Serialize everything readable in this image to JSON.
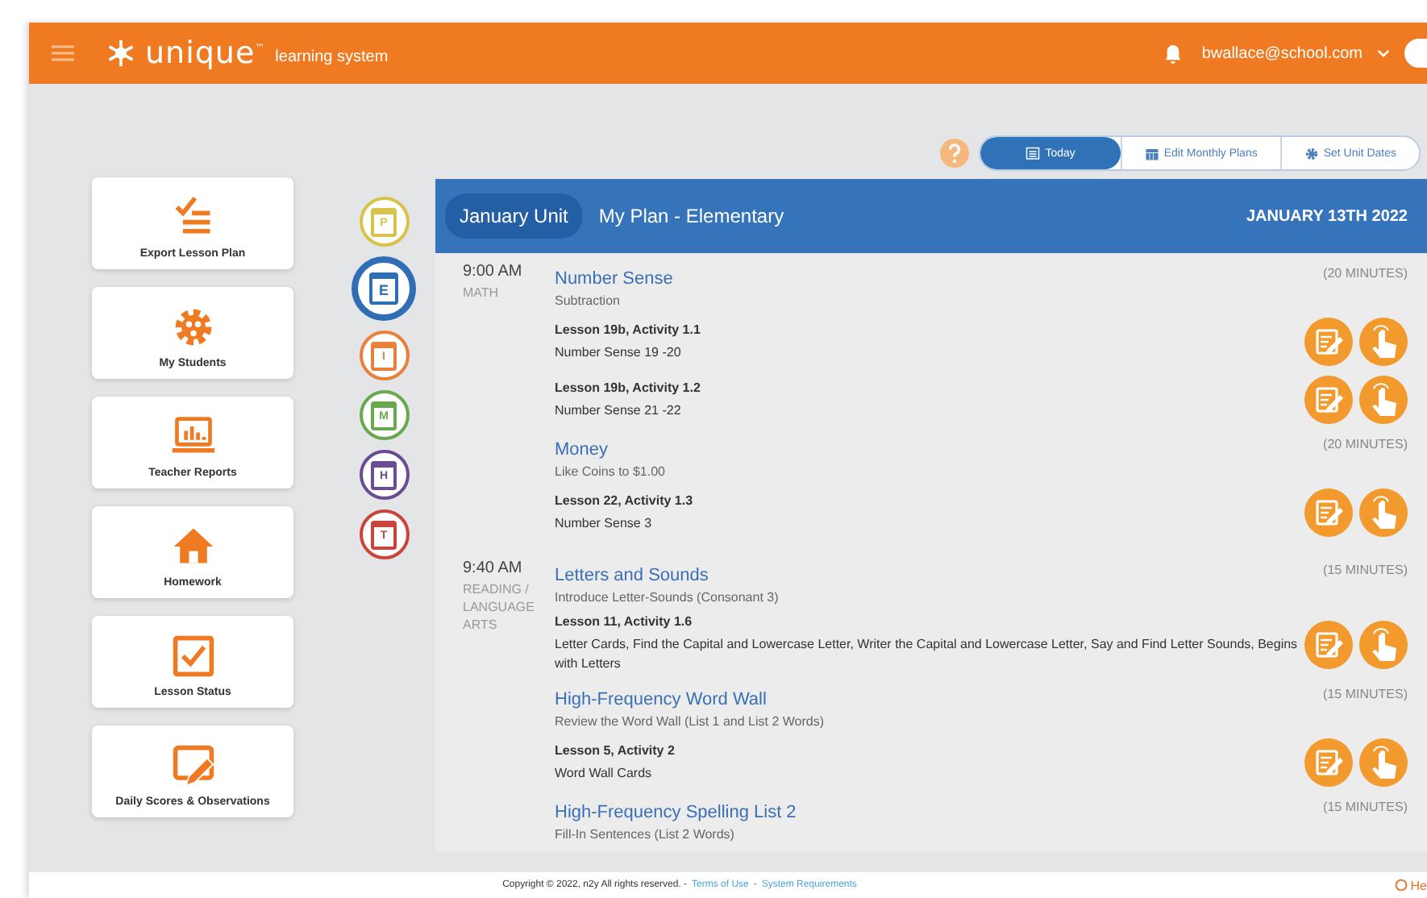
{
  "header": {
    "brand": "unique$^{™}$",
    "tagline": "learning system",
    "user": "bwallace@school.com"
  },
  "toolbar": {
    "tabs": [
      {
        "label": "Today",
        "kind": "list",
        "selected": true
      },
      {
        "label": "Edit Monthly Plans",
        "kind": "calendar",
        "selected": false
      },
      {
        "label": "Set Unit Dates",
        "kind": "gear",
        "selected": false
      }
    ]
  },
  "sidebar": {
    "items": [
      {
        "label": "Export Lesson Plan",
        "kind": "checklist"
      },
      {
        "label": "My Students",
        "kind": "gear"
      },
      {
        "label": "Teacher Reports",
        "kind": "laptop"
      },
      {
        "label": "Homework",
        "kind": "house"
      },
      {
        "label": "Lesson Status",
        "kind": "checkbox"
      },
      {
        "label": "Daily Scores & Observations",
        "kind": "tablet"
      }
    ]
  },
  "levels": [
    {
      "letter": "P",
      "color": "#d9c24a",
      "selected": false
    },
    {
      "letter": "E",
      "color": "#2f6db5",
      "selected": true
    },
    {
      "letter": "I",
      "color": "#e8813c",
      "selected": false
    },
    {
      "letter": "M",
      "color": "#6aa84f",
      "selected": false
    },
    {
      "letter": "H",
      "color": "#6a4c93",
      "selected": false
    },
    {
      "letter": "T",
      "color": "#c9453c",
      "selected": false
    }
  ],
  "plan": {
    "unit": "January Unit",
    "title": "My Plan - Elementary",
    "date": "JANUARY 13TH 2022",
    "blocks": [
      {
        "time": "9:00 AM",
        "subject": "MATH",
        "topics": [
          {
            "title": "Number Sense",
            "subtitle": "Subtraction",
            "duration": "(20 MINUTES)",
            "lessons": [
              {
                "title": "Lesson 19b, Activity 1.1",
                "detail": "Number Sense 19 -20"
              },
              {
                "title": "Lesson 19b, Activity 1.2",
                "detail": "Number Sense 21 -22"
              }
            ]
          },
          {
            "title": "Money",
            "subtitle": "Like Coins to $1.00",
            "duration": "(20 MINUTES)",
            "lessons": [
              {
                "title": "Lesson 22, Activity 1.3",
                "detail": "Number Sense 3"
              }
            ]
          }
        ]
      },
      {
        "time": "9:40 AM",
        "subject": "READING / LANGUAGE ARTS",
        "topics": [
          {
            "title": "Letters and Sounds",
            "subtitle": "Introduce Letter-Sounds (Consonant 3)",
            "duration": "(15 MINUTES)",
            "lessons": [
              {
                "title": "Lesson 11, Activity 1.6",
                "detail": "Letter Cards, Find the Capital and Lowercase Letter, Writer the Capital and Lowercase Letter, Say and Find Letter Sounds, Begins with Letters"
              }
            ]
          },
          {
            "title": "High-Frequency Word Wall",
            "subtitle": "Review the Word Wall (List 1 and List 2 Words)",
            "duration": "(15 MINUTES)",
            "lessons": [
              {
                "title": "Lesson 5, Activity 2",
                "detail": "Word Wall Cards"
              }
            ]
          },
          {
            "title": "High-Frequency Spelling List 2",
            "subtitle": "Fill-In Sentences (List 2 Words)",
            "duration": "(15 MINUTES)"
          }
        ]
      }
    ]
  },
  "footer": {
    "copyright": "Copyright © 2022, n2y All rights reserved. -",
    "links": [
      "Terms of Use",
      "System Requirements"
    ],
    "separator": "-",
    "help": "He"
  }
}
